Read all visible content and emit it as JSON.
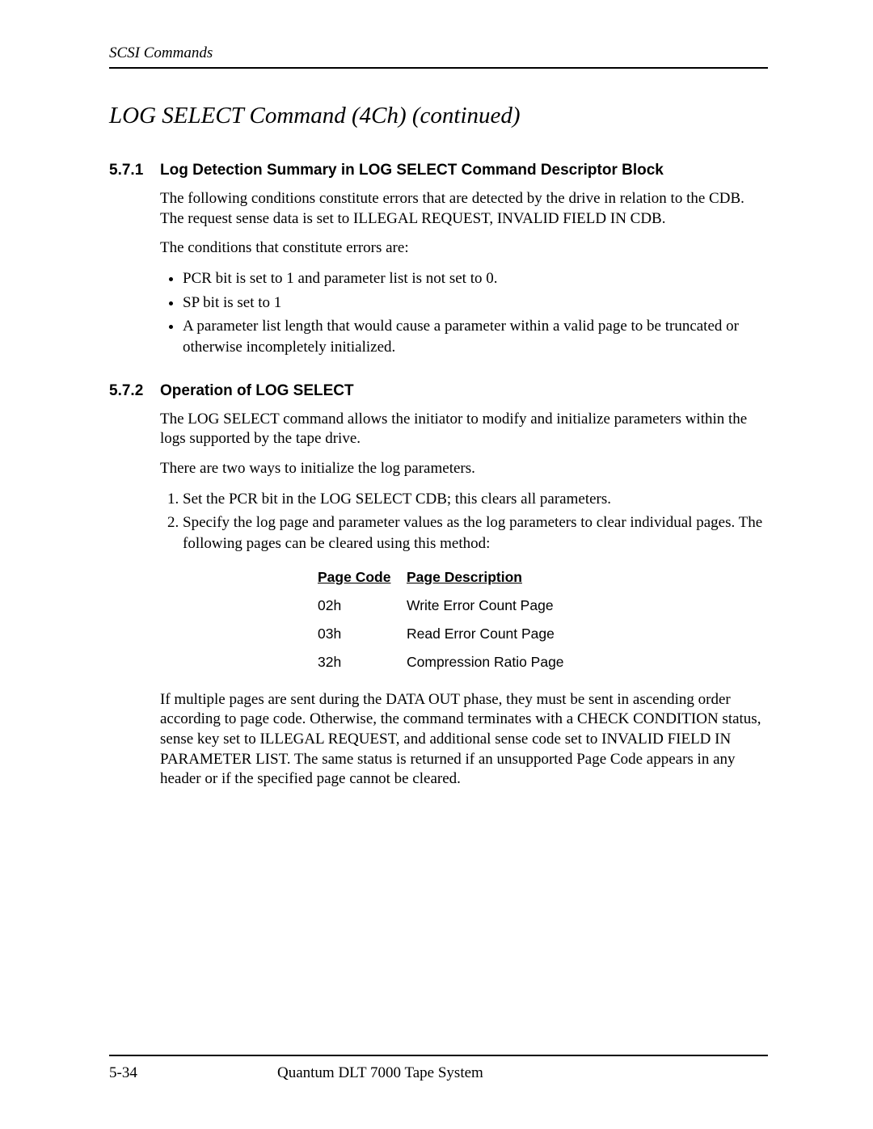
{
  "running_header": "SCSI Commands",
  "chapter_title": "LOG SELECT Command  (4Ch)   (continued)",
  "sections": [
    {
      "number": "5.7.1",
      "title": "Log Detection Summary in LOG SELECT Command Descriptor Block",
      "paragraphs": [
        "The following conditions constitute errors that are detected by the drive in relation to the CDB. The request sense data is set to ILLEGAL REQUEST, INVALID FIELD IN CDB.",
        "The conditions that constitute errors are:"
      ],
      "bullets": [
        "PCR bit is set to 1 and parameter list is not set to 0.",
        "SP bit is set to 1",
        "A parameter list length that would cause a parameter within a valid page to be truncated or otherwise incompletely initialized."
      ]
    },
    {
      "number": "5.7.2",
      "title": "Operation of LOG SELECT",
      "paragraphs": [
        "The LOG SELECT command allows the initiator to modify and initialize parameters within the logs supported by the tape drive.",
        "There are two ways to initialize the log parameters."
      ],
      "ordered": [
        "Set the PCR bit in the LOG SELECT CDB; this clears all parameters.",
        "Specify the log page and parameter values as the log parameters to clear individual pages. The following pages can be cleared using this method:"
      ],
      "after_paragraph": "If multiple pages are sent during the DATA OUT phase, they must be sent in ascending order according to page code. Otherwise, the command terminates with a CHECK CONDITION status, sense key set to ILLEGAL REQUEST, and additional sense code set to INVALID FIELD IN PARAMETER LIST. The same status is returned if an unsupported Page Code appears in any header or if the specified page cannot be cleared."
    }
  ],
  "table": {
    "headers": {
      "code": "Page Code",
      "desc": "Page Description"
    },
    "rows": [
      {
        "code": "02h",
        "desc": "Write Error Count Page"
      },
      {
        "code": "03h",
        "desc": "Read Error Count Page"
      },
      {
        "code": "32h",
        "desc": "Compression Ratio Page"
      }
    ]
  },
  "footer": {
    "page": "5-34",
    "title": "Quantum DLT 7000 Tape System"
  }
}
